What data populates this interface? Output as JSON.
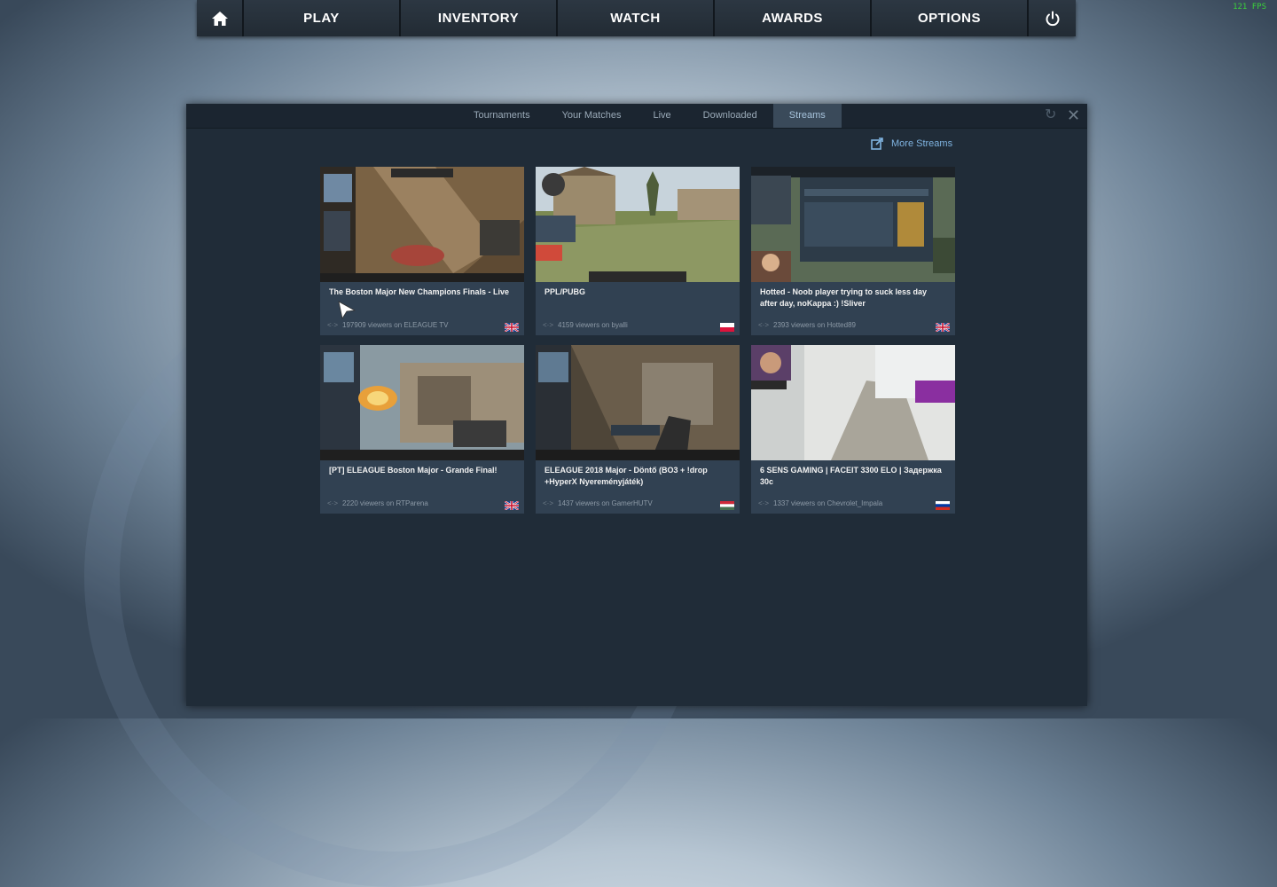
{
  "fps": "121 FPS",
  "nav": {
    "items": [
      "PLAY",
      "INVENTORY",
      "WATCH",
      "AWARDS",
      "OPTIONS"
    ],
    "home_icon": "home-icon",
    "power_icon": "power-icon"
  },
  "panel": {
    "tabs": [
      "Tournaments",
      "Your Matches",
      "Live",
      "Downloaded",
      "Streams"
    ],
    "active_tab": "Streams",
    "more_streams": "More Streams"
  },
  "streams": [
    {
      "title": "The Boston Major New Champions Finals - Live",
      "viewers": "197909 viewers on ELEAGUE TV",
      "flag": "gb"
    },
    {
      "title": "PPL/PUBG",
      "viewers": "4159 viewers on byalli",
      "flag": "pl"
    },
    {
      "title": "Hotted - Noob player trying to suck less day after day, noKappa :) !Sliver",
      "viewers": "2393 viewers on Hotted89",
      "flag": "gb"
    },
    {
      "title": "[PT] ELEAGUE Boston Major - Grande Final!",
      "viewers": "2220 viewers on RTParena",
      "flag": "gb"
    },
    {
      "title": "ELEAGUE 2018 Major - Döntő (BO3 + !drop +HyperX Nyereményjáték)",
      "viewers": "1437 viewers on GamerHUTV",
      "flag": "hu"
    },
    {
      "title": "6 SENS GAMING | FACEIT 3300 ELO | Задержка 30с",
      "viewers": "1337 viewers on Chevrolet_Impala",
      "flag": "ru"
    }
  ],
  "colors": {
    "panel_bg": "#202c38",
    "card_bg": "#314152",
    "link": "#7fb3e0",
    "active_tab": "#3a4a5a"
  }
}
